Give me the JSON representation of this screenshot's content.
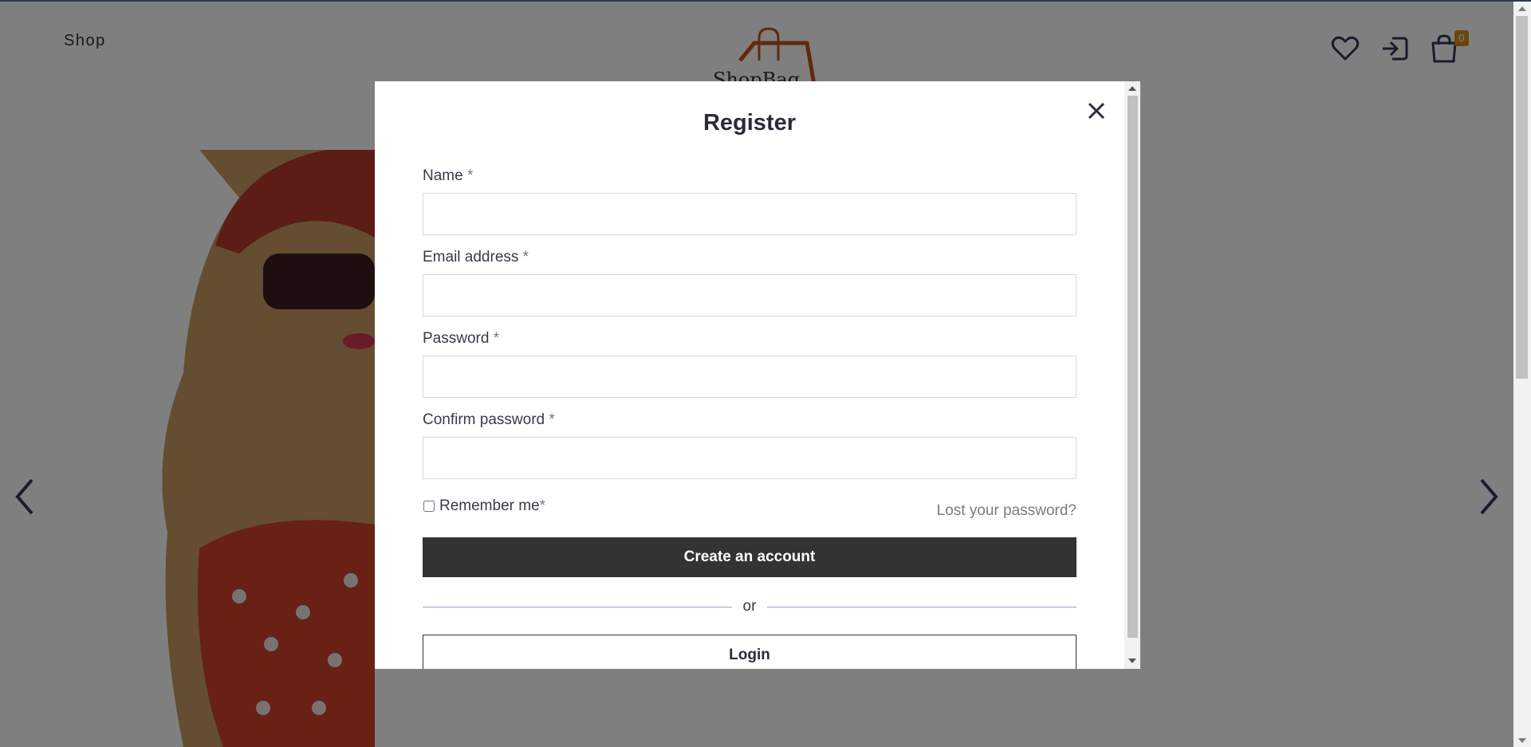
{
  "header": {
    "nav_shop": "Shop",
    "logo_text": "ShopBag",
    "cart_count": "0"
  },
  "modal": {
    "title": "Register",
    "fields": [
      {
        "label": "Name",
        "required_mark": "*",
        "value": "",
        "placeholder": ""
      },
      {
        "label": "Email address",
        "required_mark": "*",
        "value": "",
        "placeholder": ""
      },
      {
        "label": "Password",
        "required_mark": "*",
        "value": "",
        "placeholder": ""
      },
      {
        "label": "Confirm password",
        "required_mark": "*",
        "value": "",
        "placeholder": ""
      }
    ],
    "remember_label": "Remember me",
    "remember_required": "*",
    "remember_checked": false,
    "lost_password": "Lost your password?",
    "create_button": "Create an account",
    "or_text": "or",
    "login_button": "Login"
  },
  "icons": {
    "wishlist": "heart-icon",
    "login": "login-icon",
    "cart": "shopping-bag-icon",
    "close": "close-icon",
    "prev": "chevron-left-icon",
    "next": "chevron-right-icon"
  },
  "colors": {
    "overlay": "#808080",
    "primary_button": "#333333",
    "badge": "#d78a1c",
    "logo_accent": "#c2521f"
  }
}
